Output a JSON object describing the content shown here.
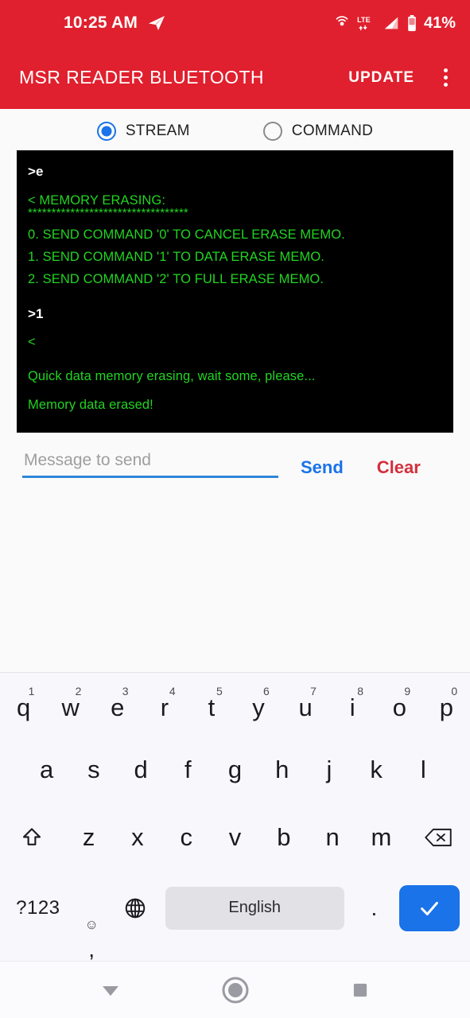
{
  "status_bar": {
    "time": "10:25 AM",
    "telegram_icon": "telegram-paper-plane-icon",
    "hotspot_icon": "hotspot-icon",
    "network_label": "LTE",
    "signal_icon": "signal-bars-icon",
    "battery_icon": "battery-icon",
    "battery_percent": "41%",
    "background_color": "#e0202e"
  },
  "app_bar": {
    "title": "MSR READER BLUETOOTH",
    "update_label": "UPDATE",
    "overflow_icon": "kebab-menu-icon",
    "background_color": "#e0202e",
    "text_color": "#ffffff"
  },
  "mode_selector": {
    "options": [
      {
        "label": "STREAM",
        "selected": true
      },
      {
        "label": "COMMAND",
        "selected": false
      }
    ],
    "accent_color": "#1a73e8"
  },
  "terminal": {
    "background_color": "#000000",
    "rx_color": "#21d421",
    "tx_color": "#ffffff",
    "lines": [
      {
        "type": "tx",
        "text": ">e"
      },
      {
        "type": "gap"
      },
      {
        "type": "rx",
        "text": "< MEMORY ERASING:"
      },
      {
        "type": "stars",
        "text": "**********************************"
      },
      {
        "type": "rx",
        "text": "0. SEND COMMAND '0' TO CANCEL ERASE MEMO."
      },
      {
        "type": "rx",
        "text": "1. SEND COMMAND '1' TO DATA ERASE MEMO."
      },
      {
        "type": "rx",
        "text": "2. SEND COMMAND '2' TO FULL ERASE MEMO."
      },
      {
        "type": "gap"
      },
      {
        "type": "tx",
        "text": ">1"
      },
      {
        "type": "gap"
      },
      {
        "type": "rx",
        "text": "<"
      },
      {
        "type": "gap-lg"
      },
      {
        "type": "rx",
        "text": "Quick data memory erasing, wait some, please..."
      },
      {
        "type": "gap"
      },
      {
        "type": "rx",
        "text": "Memory data erased!"
      }
    ],
    "line_0": ">e",
    "line_1": "< MEMORY ERASING:",
    "line_2": "**********************************",
    "line_3": "0. SEND COMMAND '0' TO CANCEL ERASE MEMO.",
    "line_4": "1. SEND COMMAND '1' TO DATA ERASE MEMO.",
    "line_5": "2. SEND COMMAND '2' TO FULL ERASE MEMO.",
    "line_6": ">1",
    "line_7": "<",
    "line_8": "Quick data memory erasing, wait some, please...",
    "line_9": "Memory data erased!"
  },
  "send_row": {
    "input_value": "",
    "input_placeholder": "Message to send",
    "send_label": "Send",
    "clear_label": "Clear",
    "send_color": "#1a73e8",
    "clear_color": "#d32f3d",
    "underline_color": "#2f86d8"
  },
  "keyboard": {
    "row1": [
      {
        "letter": "q",
        "number": "1"
      },
      {
        "letter": "w",
        "number": "2"
      },
      {
        "letter": "e",
        "number": "3"
      },
      {
        "letter": "r",
        "number": "4"
      },
      {
        "letter": "t",
        "number": "5"
      },
      {
        "letter": "y",
        "number": "6"
      },
      {
        "letter": "u",
        "number": "7"
      },
      {
        "letter": "i",
        "number": "8"
      },
      {
        "letter": "o",
        "number": "9"
      },
      {
        "letter": "p",
        "number": "0"
      }
    ],
    "row2": [
      "a",
      "s",
      "d",
      "f",
      "g",
      "h",
      "j",
      "k",
      "l"
    ],
    "row3": [
      "z",
      "x",
      "c",
      "v",
      "b",
      "n",
      "m"
    ],
    "shift_icon": "shift-arrow-icon",
    "backspace_icon": "backspace-icon",
    "symbols_label": "?123",
    "emoji_icon": "smiley-face-icon",
    "comma_label": ",",
    "globe_icon": "globe-language-icon",
    "space_label": "English",
    "period_label": ".",
    "enter_icon": "checkmark-icon",
    "enter_color": "#1a73e8",
    "background_color": "#f8f8fc"
  },
  "nav_bar": {
    "back_icon": "down-triangle-back-icon",
    "home_icon": "home-circle-icon",
    "recents_icon": "recents-square-icon"
  }
}
